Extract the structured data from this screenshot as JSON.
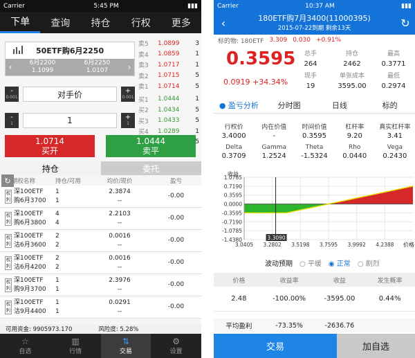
{
  "left": {
    "status": {
      "carrier": "Carrier",
      "time": "5:45 PM"
    },
    "tabs": [
      "下单",
      "查询",
      "持仓",
      "行权",
      "更多"
    ],
    "quote": {
      "title": "50ETF购6月2250",
      "left_month": "6月2200",
      "left_price": "1.1099",
      "right_month": "6月2250",
      "right_price": "1.0107"
    },
    "book": {
      "sell": [
        {
          "label": "卖5",
          "price": "1.0899",
          "vol": "3"
        },
        {
          "label": "卖4",
          "price": "1.0859",
          "vol": "1"
        },
        {
          "label": "卖3",
          "price": "1.0717",
          "vol": "1"
        },
        {
          "label": "卖2",
          "price": "1.0715",
          "vol": "5"
        },
        {
          "label": "卖1",
          "price": "1.0714",
          "vol": "5"
        }
      ],
      "buy": [
        {
          "label": "买1",
          "price": "1.0444",
          "vol": "1"
        },
        {
          "label": "买2",
          "price": "1.0434",
          "vol": "5"
        },
        {
          "label": "买3",
          "price": "1.0433",
          "vol": "5"
        },
        {
          "label": "买4",
          "price": "1.0289",
          "vol": "1"
        },
        {
          "label": "买5",
          "price": "1.0212",
          "vol": "5"
        }
      ]
    },
    "price_ctrl": {
      "minus": "-",
      "minus_step": "0.001",
      "value": "对手价",
      "plus": "+",
      "plus_step": "0.001"
    },
    "qty_ctrl": {
      "minus": "-",
      "minus_step": "1",
      "value": "1",
      "plus": "+",
      "plus_step": "1"
    },
    "buy_open": {
      "price": "1.0714",
      "label": "买开"
    },
    "sell_close": {
      "price": "1.0444",
      "label": "卖平"
    },
    "hold_tabs": {
      "positions": "持仓",
      "orders": "委托"
    },
    "table_head": [
      "期权名称",
      "持仓/可用",
      "均价/现价",
      "盈亏"
    ],
    "rows": [
      {
        "tag": "权利",
        "name1": "深100ETF",
        "name2": "购6月3700",
        "hold": "1",
        "avail": "1",
        "avg": "2.3874",
        "cur": "--",
        "pl": "-0.00"
      },
      {
        "tag": "权利",
        "name1": "深100ETF",
        "name2": "购6月3800",
        "hold": "4",
        "avail": "4",
        "avg": "2.2103",
        "cur": "--",
        "pl": "-0.00"
      },
      {
        "tag": "权利",
        "name1": "深100ETF",
        "name2": "沽6月3600",
        "hold": "2",
        "avail": "2",
        "avg": "0.0016",
        "cur": "--",
        "pl": "-0.00"
      },
      {
        "tag": "权利",
        "name1": "深100ETF",
        "name2": "沽6月4200",
        "hold": "2",
        "avail": "2",
        "avg": "0.0016",
        "cur": "--",
        "pl": "-0.00"
      },
      {
        "tag": "权利",
        "name1": "深100ETF",
        "name2": "购9月3700",
        "hold": "1",
        "avail": "1",
        "avg": "2.3976",
        "cur": "--",
        "pl": "-0.00"
      },
      {
        "tag": "权利",
        "name1": "深100ETF",
        "name2": "沽9月4400",
        "hold": "1",
        "avail": "1",
        "avg": "0.0291",
        "cur": "--",
        "pl": "-0.00"
      }
    ],
    "funds": {
      "available": "可用资金: 9905973.170",
      "risk": "风险度:      5.28%"
    },
    "bottom_nav": [
      {
        "icon": "☆",
        "label": "自选"
      },
      {
        "icon": "▥",
        "label": "行情"
      },
      {
        "icon": "⇅",
        "label": "交易"
      },
      {
        "icon": "⚙",
        "label": "设置"
      }
    ]
  },
  "right": {
    "status": {
      "carrier": "Carrier",
      "time": "10:37 AM"
    },
    "nav": {
      "title": "180ETF购7月3400(11000395)",
      "subtitle": "2015-07-22到期  剩余13天"
    },
    "underlying": {
      "label": "标的物: 180ETF",
      "price": "3.309",
      "change": "0.030",
      "pct": "+0.91%"
    },
    "last_price": "0.3595",
    "change_line": "0.0919  +34.34%",
    "metrics": [
      {
        "k": "总手",
        "v": "264"
      },
      {
        "k": "持仓",
        "v": "2462"
      },
      {
        "k": "最高",
        "v": "0.3771"
      },
      {
        "k": "现手",
        "v": "19"
      },
      {
        "k": "单张成本",
        "v": "3595.00"
      },
      {
        "k": "最低",
        "v": "0.2974"
      }
    ],
    "sub_tabs": [
      "● 盈亏分析",
      "分时图",
      "日线",
      "标的"
    ],
    "greeks_head1": [
      "行权价",
      "内在价值",
      "时间价值",
      "杠杆率",
      "真实杠杆率"
    ],
    "greeks_val1": [
      "3.4000",
      "-",
      "0.3595",
      "9.20",
      "3.41"
    ],
    "greeks_head2": [
      "Delta",
      "Gamma",
      "Theta",
      "Rho",
      "Vega"
    ],
    "greeks_val2": [
      "0.3709",
      "1.2524",
      "-1.5324",
      "0.0440",
      "0.2430"
    ],
    "chart_data": {
      "type": "line",
      "ylabel": "收益",
      "xlabel": "价格",
      "y_ticks": [
        "1.0785",
        "0.7190",
        "0.3595",
        "0.0000",
        "-0.3595",
        "-0.7190",
        "-1.0785",
        "-1.4380"
      ],
      "x_ticks": [
        "3.0405",
        "3.2802",
        "3.5198",
        "3.7595",
        "3.9992",
        "4.2388"
      ],
      "cursor_label": "3.3090",
      "series": [
        {
          "x": [
            3.0405,
            3.4,
            3.7595,
            4.4785
          ],
          "values": [
            -0.3595,
            -0.3595,
            0.0,
            0.719
          ]
        }
      ],
      "xlim": [
        3.0405,
        4.4785
      ],
      "ylim": [
        -1.438,
        1.0785
      ],
      "cursor_x": 3.309
    },
    "vol": {
      "label": "波动预期",
      "opt1": "○ 平缓",
      "opt2": "◉ 正常",
      "opt3": "○ 剧烈"
    },
    "sim_head": [
      "价格",
      "收益率",
      "收益",
      "发生概率"
    ],
    "sim_rows": [
      {
        "price": "2.48",
        "rate": "-100.00%",
        "gain": "-3595.00",
        "prob": "0.44%"
      }
    ],
    "avg": {
      "label": "平均盈利",
      "rate": "-73.35%",
      "gain": "-2636.76"
    },
    "buttons": {
      "trade": "交易",
      "watch": "加自选"
    }
  }
}
